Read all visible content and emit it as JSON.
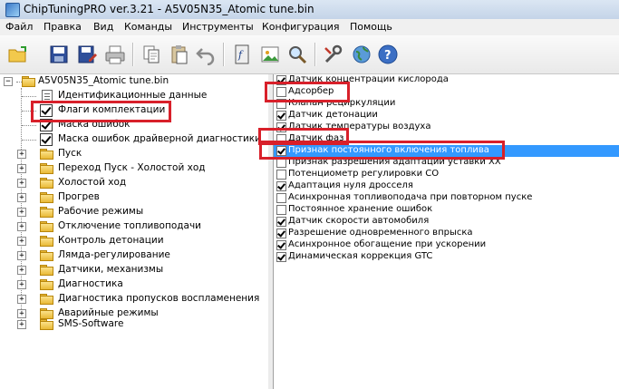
{
  "window": {
    "title": "ChipTuningPRO ver.3.21  -  A5V05N35_Atomic tune.bin"
  },
  "menu": [
    "Файл",
    "Правка",
    "Вид",
    "Команды",
    "Инструменты",
    "Конфигурация",
    "Помощь"
  ],
  "toolbar": {
    "icons": [
      "open-folder-icon",
      "save-icon",
      "save-as-icon",
      "print-icon",
      "copy-icon",
      "paste-icon",
      "undo-icon",
      "calculator-icon",
      "search-icon",
      "tools-icon",
      "globe-icon",
      "help-icon"
    ]
  },
  "tree": {
    "root": "A5V05N35_Atomic tune.bin",
    "items": [
      {
        "label": "Идентификационные данные",
        "icon": "document-icon"
      },
      {
        "label": "Флаги комплектации",
        "icon": "checkbox-icon"
      },
      {
        "label": "Маска ошибок",
        "icon": "checkbox-icon"
      },
      {
        "label": "Маска ошибок драйверной диагностики",
        "icon": "checkbox-icon"
      },
      {
        "label": "Пуск",
        "icon": "folder-icon"
      },
      {
        "label": "Переход Пуск - Холостой ход",
        "icon": "folder-icon"
      },
      {
        "label": "Холостой ход",
        "icon": "folder-icon"
      },
      {
        "label": "Прогрев",
        "icon": "folder-icon"
      },
      {
        "label": "Рабочие режимы",
        "icon": "folder-icon"
      },
      {
        "label": "Отключение топливоподачи",
        "icon": "folder-icon"
      },
      {
        "label": "Контроль детонации",
        "icon": "folder-icon"
      },
      {
        "label": "Лямда-регулирование",
        "icon": "folder-icon"
      },
      {
        "label": "Датчики, механизмы",
        "icon": "folder-icon"
      },
      {
        "label": "Диагностика",
        "icon": "folder-icon"
      },
      {
        "label": "Диагностика пропусков воспламенения",
        "icon": "folder-icon"
      },
      {
        "label": "Аварийные режимы",
        "icon": "folder-icon"
      },
      {
        "label": "SMS-Software",
        "icon": "folder-icon"
      }
    ]
  },
  "flags": [
    {
      "label": "Датчик концентрации кислорода",
      "checked": true
    },
    {
      "label": "Адсорбер",
      "checked": false
    },
    {
      "label": "Клапан рециркуляции",
      "checked": false
    },
    {
      "label": "Датчик детонации",
      "checked": true
    },
    {
      "label": "Датчик температуры воздуха",
      "checked": true
    },
    {
      "label": "Датчик фаз",
      "checked": false
    },
    {
      "label": "Признак постоянного включения топлива",
      "checked": true,
      "selected": true
    },
    {
      "label": "Признак разрешения адаптации уставки ХХ",
      "checked": false
    },
    {
      "label": "Потенциометр регулировки СО",
      "checked": false
    },
    {
      "label": "Адаптация нуля дросселя",
      "checked": true
    },
    {
      "label": "Асинхронная топливоподача при повторном пуске",
      "checked": false
    },
    {
      "label": "Постоянное хранение ошибок",
      "checked": false
    },
    {
      "label": "Датчик скорости автомобиля",
      "checked": true
    },
    {
      "label": "Разрешение одновременного впрыска",
      "checked": true
    },
    {
      "label": "Асинхронное обогащение при ускорении",
      "checked": true
    },
    {
      "label": "Динамическая коррекция GTC",
      "checked": true
    }
  ],
  "colors": {
    "highlight_frame": "#d8202a",
    "selection": "#3399ff"
  }
}
